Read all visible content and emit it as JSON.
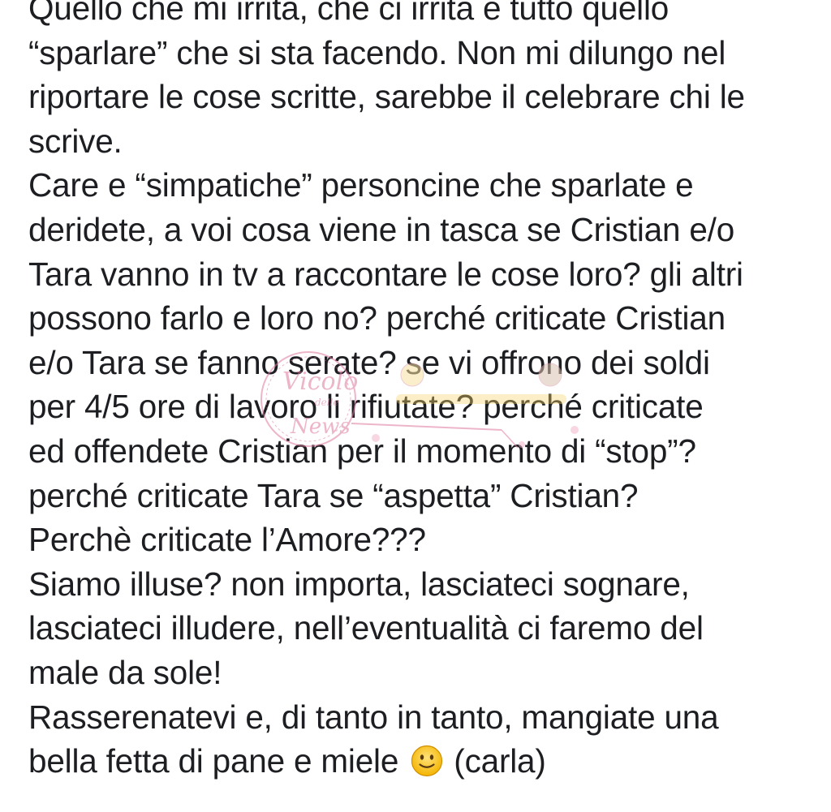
{
  "post": {
    "lines": [
      "Quello che mi irrita, che ci irrita è tutto quello",
      "“sparlare” che si sta facendo. Non mi dilungo nel",
      "riportare le cose scritte, sarebbe il celebrare chi le",
      "scrive.",
      "Care e “simpatiche” personcine che sparlate e",
      "deridete, a voi cosa viene in tasca se Cristian e/o",
      "Tara vanno in tv a raccontare le cose loro? gli altri",
      "possono farlo e loro no? perché criticate Cristian",
      "e/o Tara se fanno serate? se vi offrono dei soldi",
      "per 4/5 ore di lavoro li rifiutate? perché criticate",
      "ed offendete Cristian per il momento di “stop”?",
      "perché criticate Tara se “aspetta” Cristian?",
      "Perchè criticate l’Amore???",
      "Siamo illuse? non importa, lasciateci sognare,",
      "lasciateci illudere, nell’eventualità ci faremo del",
      "male da sole!",
      "Rasserenatevi e, di tanto in tanto, mangiate una"
    ],
    "last_line_before_emoji": "bella fetta di pane e miele",
    "last_line_after_emoji": "(carla)",
    "emoji_icon": "slightly-smiling-face-icon"
  },
  "watermark": {
    "text_top": "Vicolo",
    "text_small": "delle",
    "text_bottom": "News",
    "color": "#e07aa0"
  }
}
